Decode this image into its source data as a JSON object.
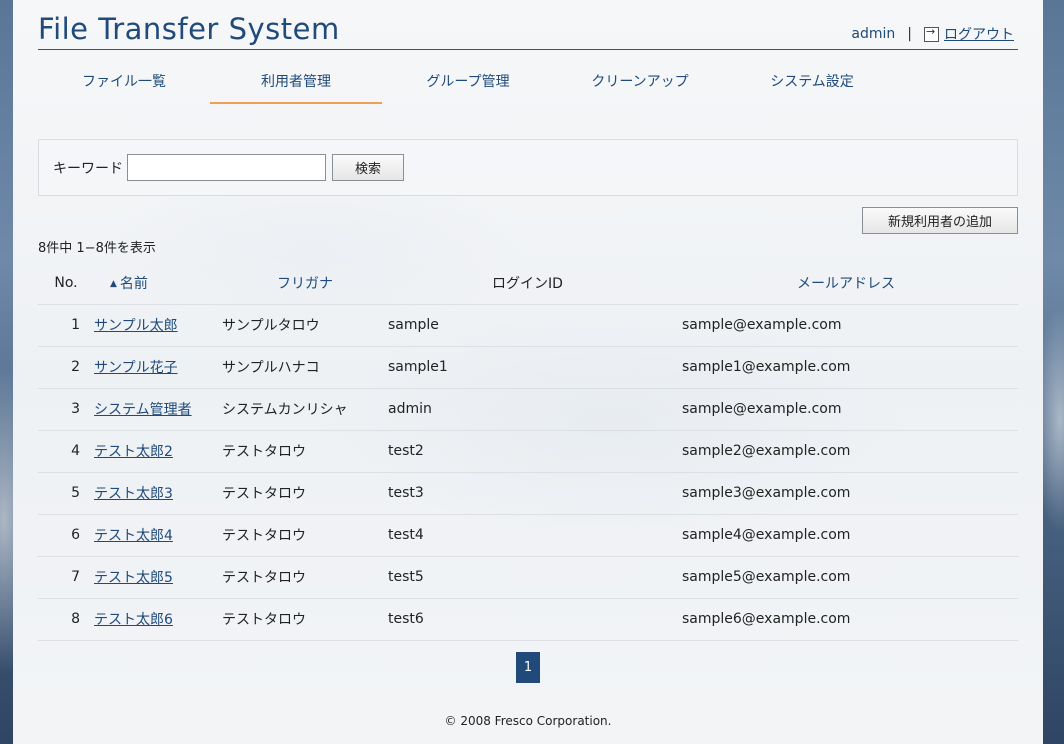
{
  "app": {
    "title": "File Transfer System"
  },
  "user": {
    "name": "admin",
    "separator": "|",
    "logout_label": "ログアウト"
  },
  "nav": {
    "tabs": [
      {
        "label": "ファイル一覧"
      },
      {
        "label": "利用者管理"
      },
      {
        "label": "グループ管理"
      },
      {
        "label": "クリーンアップ"
      },
      {
        "label": "システム設定"
      }
    ],
    "active": "利用者管理"
  },
  "search": {
    "label": "キーワード",
    "value": "",
    "placeholder": "",
    "button_label": "検索"
  },
  "add_user_label": "新規利用者の追加",
  "count_text": "8件中 1−8件を表示",
  "table": {
    "headers": {
      "no": "No.",
      "name": "名前",
      "kana": "フリガナ",
      "login": "ログインID",
      "mail": "メールアドレス"
    },
    "sort_indicator": "▲",
    "rows": [
      {
        "no": "1",
        "name": "サンプル太郎",
        "kana": "サンプルタロウ",
        "login": "sample",
        "mail": "sample@example.com"
      },
      {
        "no": "2",
        "name": "サンプル花子",
        "kana": "サンプルハナコ",
        "login": "sample1",
        "mail": "sample1@example.com"
      },
      {
        "no": "3",
        "name": "システム管理者",
        "kana": "システムカンリシャ",
        "login": "admin",
        "mail": "sample@example.com"
      },
      {
        "no": "4",
        "name": "テスト太郎2",
        "kana": "テストタロウ",
        "login": "test2",
        "mail": "sample2@example.com"
      },
      {
        "no": "5",
        "name": "テスト太郎3",
        "kana": "テストタロウ",
        "login": "test3",
        "mail": "sample3@example.com"
      },
      {
        "no": "6",
        "name": "テスト太郎4",
        "kana": "テストタロウ",
        "login": "test4",
        "mail": "sample4@example.com"
      },
      {
        "no": "7",
        "name": "テスト太郎5",
        "kana": "テストタロウ",
        "login": "test5",
        "mail": "sample5@example.com"
      },
      {
        "no": "8",
        "name": "テスト太郎6",
        "kana": "テストタロウ",
        "login": "test6",
        "mail": "sample6@example.com"
      }
    ]
  },
  "pagination": {
    "current": "1"
  },
  "footer": {
    "copyright": "© 2008 Fresco Corporation."
  },
  "colors": {
    "brand": "#1f4a7a",
    "tab_active_underline": "#f0a050"
  }
}
